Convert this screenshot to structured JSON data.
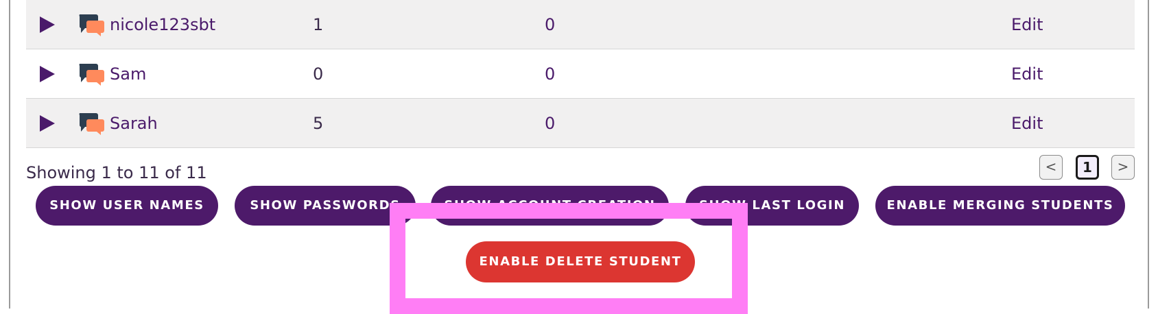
{
  "students": [
    {
      "name": "nicole123sbt",
      "col1": "1",
      "col2": "0",
      "edit": "Edit"
    },
    {
      "name": "Sam",
      "col1": "0",
      "col2": "0",
      "edit": "Edit"
    },
    {
      "name": "Sarah",
      "col1": "5",
      "col2": "0",
      "edit": "Edit"
    }
  ],
  "pagination": {
    "showing": "Showing 1 to 11 of 11",
    "prev": "<",
    "current": "1",
    "next": ">"
  },
  "actions": {
    "show_user_names": "SHOW USER NAMES",
    "show_passwords": "SHOW PASSWORDS",
    "show_account_creation": "SHOW ACCOUNT CREATION",
    "show_last_login": "SHOW LAST LOGIN",
    "enable_merging": "ENABLE MERGING STUDENTS",
    "enable_delete": "ENABLE DELETE STUDENT"
  },
  "colors": {
    "primary": "#4d1a6a",
    "danger": "#dc3631",
    "highlight": "#ff7ef5",
    "row_shade": "#f1f0f0",
    "chat_dark": "#2c3e50",
    "chat_orange": "#ff8a5c"
  },
  "icons": {
    "expand": "play-triangle-icon",
    "chat": "chat-bubbles-icon"
  }
}
